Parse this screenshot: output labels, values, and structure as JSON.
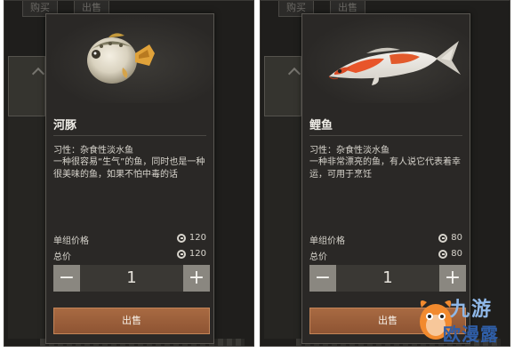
{
  "background": {
    "tab_buy": "购买",
    "tab_sell": "出售"
  },
  "cards": [
    {
      "fish_name": "河豚",
      "habit": "习性：杂食性淡水鱼",
      "description": "一种很容易“生气”的鱼，同时也是一种很美味的鱼，如果不怕中毒的话",
      "unit_price_label": "单组价格",
      "unit_price": "120",
      "total_label": "总价",
      "total": "120",
      "quantity": "1",
      "sell_label": "出售",
      "icon": "pufferfish-icon"
    },
    {
      "fish_name": "鲤鱼",
      "habit": "习性：杂食性淡水鱼",
      "description": "一种非常漂亮的鱼，有人说它代表着幸运，可用于烹饪",
      "unit_price_label": "单组价格",
      "unit_price": "80",
      "total_label": "总价",
      "total": "80",
      "quantity": "1",
      "sell_label": "出售",
      "icon": "koi-icon"
    }
  ],
  "watermark": {
    "line1": "九游",
    "line2": "欧漫露"
  },
  "colors": {
    "card_bg": "#2a2826",
    "sell_button": "#9c5f3b",
    "stepper_button": "#8a8780"
  }
}
